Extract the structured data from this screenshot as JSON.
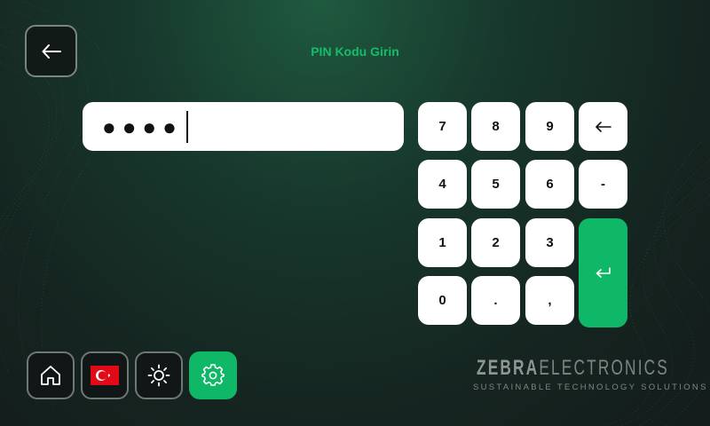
{
  "header": {
    "title": "PIN Kodu Girin"
  },
  "back_button": {
    "icon": "arrow-left-icon"
  },
  "pin": {
    "masked_value": "●●●●"
  },
  "keypad": {
    "keys": [
      {
        "id": "7",
        "label": "7"
      },
      {
        "id": "8",
        "label": "8"
      },
      {
        "id": "9",
        "label": "9"
      },
      {
        "id": "backspace",
        "label": "",
        "icon": "arrow-left-icon"
      },
      {
        "id": "4",
        "label": "4"
      },
      {
        "id": "5",
        "label": "5"
      },
      {
        "id": "6",
        "label": "6"
      },
      {
        "id": "minus",
        "label": "-"
      },
      {
        "id": "1",
        "label": "1"
      },
      {
        "id": "2",
        "label": "2"
      },
      {
        "id": "3",
        "label": "3"
      },
      {
        "id": "enter",
        "label": "",
        "icon": "enter-icon"
      },
      {
        "id": "0",
        "label": "0"
      },
      {
        "id": "dot",
        "label": "."
      },
      {
        "id": "comma",
        "label": ","
      }
    ]
  },
  "bottom_bar": {
    "items": [
      {
        "id": "home",
        "icon": "home-icon"
      },
      {
        "id": "language",
        "icon": "turkey-flag-icon"
      },
      {
        "id": "brightness",
        "icon": "sun-icon"
      },
      {
        "id": "settings",
        "icon": "gear-icon"
      }
    ]
  },
  "brand": {
    "name_part1": "ZEBRA",
    "name_part2": "ELECTRONICS",
    "tagline": "SUSTAINABLE TECHNOLOGY SOLUTIONS"
  },
  "colors": {
    "accent": "#0fb866",
    "title": "#14bd6c",
    "background": "#17372c"
  }
}
